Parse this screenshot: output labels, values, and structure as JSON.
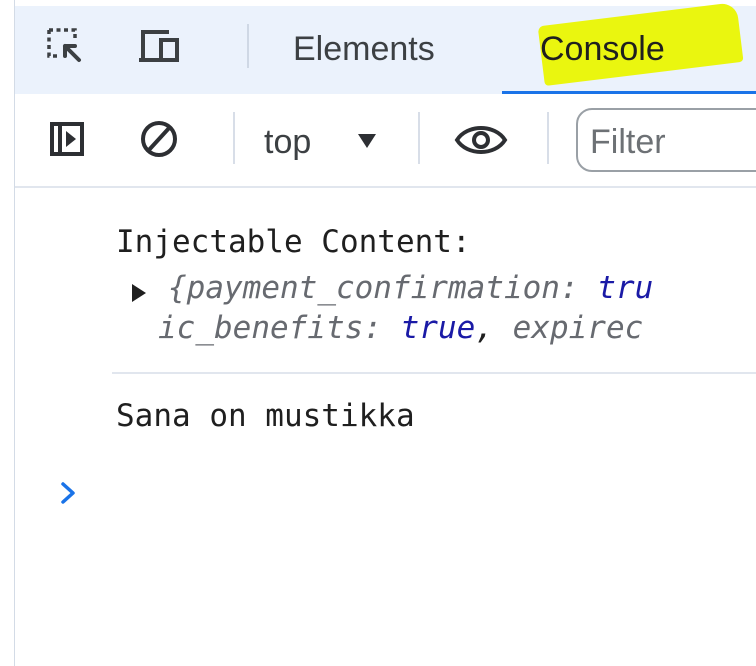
{
  "toolbar_top": {
    "inspect_icon": "inspect-element-icon",
    "device_icon": "device-toggle-icon",
    "tabs": [
      {
        "label": "Elements",
        "active": false
      },
      {
        "label": "Console",
        "active": true
      }
    ]
  },
  "console_toolbar": {
    "sidebar_icon": "sidebar-toggle-icon",
    "clear_icon": "clear-console-icon",
    "context": "top",
    "eye_icon": "live-expression-icon",
    "filter_placeholder": "Filter"
  },
  "console": {
    "messages": [
      {
        "label": "Injectable Content:",
        "object_line_1": {
          "open": "{",
          "key": "payment_confirmation",
          "sep": ": ",
          "value": "tru"
        },
        "object_line_2": {
          "key": "ic_benefits",
          "sep": ": ",
          "value": "true",
          "comma": ", ",
          "key2": "expirec"
        }
      },
      {
        "text": "Sana on mustikka"
      }
    ],
    "prompt_symbol": "chevron-right-icon"
  },
  "colors": {
    "tabbar_bg": "#ebf2fc",
    "active_tab_underline": "#1a73e8",
    "highlight": "#eaf60f",
    "object_key": "#676a70",
    "object_value": "#1a1aa6",
    "prompt": "#1a73e8"
  }
}
